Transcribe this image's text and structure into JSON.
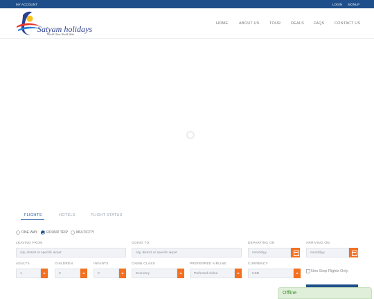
{
  "topbar": {
    "my_account": "MY ACCOUNT",
    "login": "LOGIN",
    "signup": "SIGNUP"
  },
  "logo": {
    "brand": "Satyam holidays",
    "tagline": "World Class World Wide"
  },
  "nav": [
    "HOME",
    "ABOUT US",
    "TOUR",
    "DEALS",
    "FAQS",
    "CONTACT US"
  ],
  "tabs": [
    "FLIGHTS",
    "HOTELS",
    "FLIGHT STATUS"
  ],
  "trip_types": [
    {
      "label": "ONE WAY",
      "selected": false
    },
    {
      "label": "ROUND TRIP",
      "selected": true
    },
    {
      "label": "MULTICITY",
      "selected": false
    }
  ],
  "form": {
    "leaving_from": {
      "label": "LEAVING FROM",
      "placeholder": "city, district or specific airpot"
    },
    "going_to": {
      "label": "GOING TO",
      "placeholder": "city, district or specific airpot"
    },
    "departing": {
      "label": "DEPARTING ON",
      "placeholder": "mm/dd/yy"
    },
    "arriving": {
      "label": "ARRIVING ON",
      "placeholder": "mm/dd/yy"
    },
    "adults": {
      "label": "ADULTS",
      "value": "1"
    },
    "children": {
      "label": "CHILDREN",
      "value": "0"
    },
    "infants": {
      "label": "INFANTS",
      "value": "0"
    },
    "cabin_class": {
      "label": "CABIN CLASS",
      "value": "Economy"
    },
    "airline": {
      "label": "PREFERRED AIRLINE",
      "value": "Preferred Airline"
    },
    "currency": {
      "label": "CURRENCY",
      "value": "USD"
    },
    "non_stop": {
      "label": "Non Stop Flights Only"
    }
  },
  "chat": {
    "status": "Offline"
  },
  "colors": {
    "brand_blue": "#1e4f8a",
    "accent_orange": "#f37021"
  }
}
